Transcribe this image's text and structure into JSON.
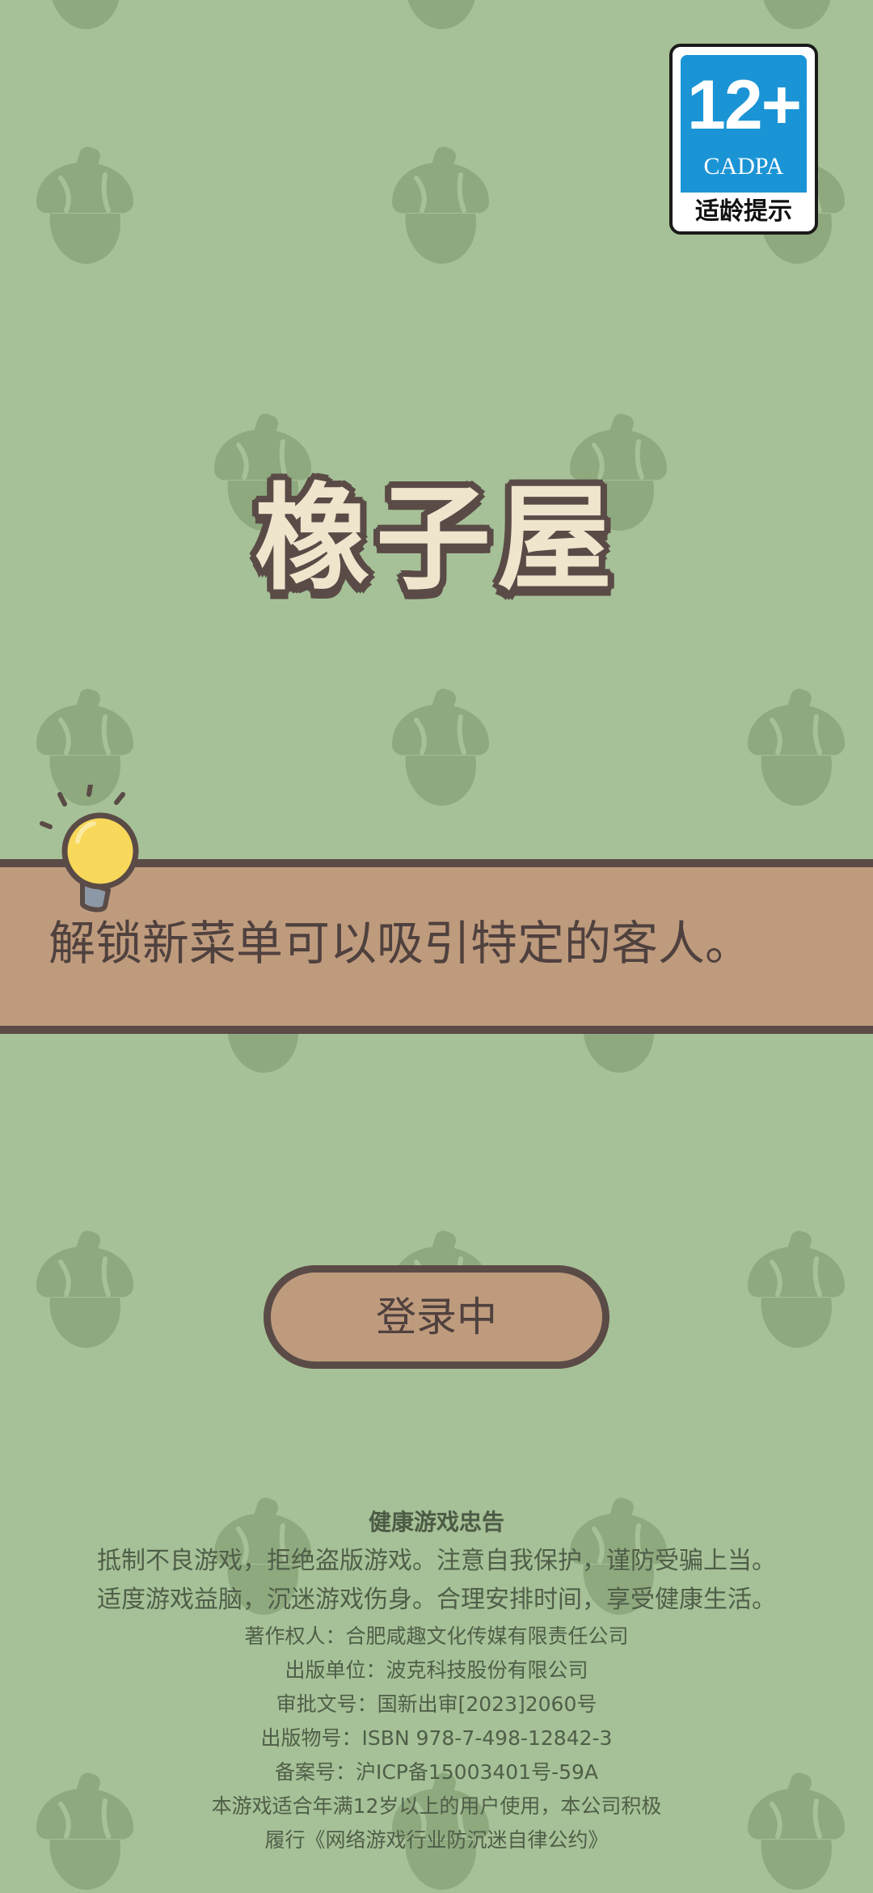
{
  "age_rating": {
    "age": "12+",
    "org": "CADPA",
    "label": "适龄提示"
  },
  "logo_title": "橡子屋",
  "tip": {
    "icon": "lightbulb-icon",
    "text": "解锁新菜单可以吸引特定的客人。"
  },
  "login_button": {
    "label": "登录中"
  },
  "footer": {
    "title": "健康游戏忠告",
    "advisory_line1": "抵制不良游戏，拒绝盗版游戏。注意自我保护，谨防受骗上当。",
    "advisory_line2": "适度游戏益脑，沉迷游戏伤身。合理安排时间，享受健康生活。",
    "copyright_owner": "著作权人：合肥咸趣文化传媒有限责任公司",
    "publisher": "出版单位：波克科技股份有限公司",
    "approval_number": "审批文号：国新出审[2023]2060号",
    "isbn": "出版物号：ISBN 978-7-498-12842-3",
    "icp": "备案号：沪ICP备15003401号-59A",
    "age_notice_line1": "本游戏适合年满12岁以上的用户使用，本公司积极",
    "age_notice_line2": "履行《网络游戏行业防沉迷自律公约》"
  },
  "colors": {
    "background": "#a6c197",
    "acorn_pattern": "#8fa97f",
    "banner_fill": "#bf9b7d",
    "outline_brown": "#5a4b47",
    "logo_fill": "#efe4cc",
    "age_badge_blue": "#1b94d6",
    "bulb_yellow": "#f7d85a"
  }
}
